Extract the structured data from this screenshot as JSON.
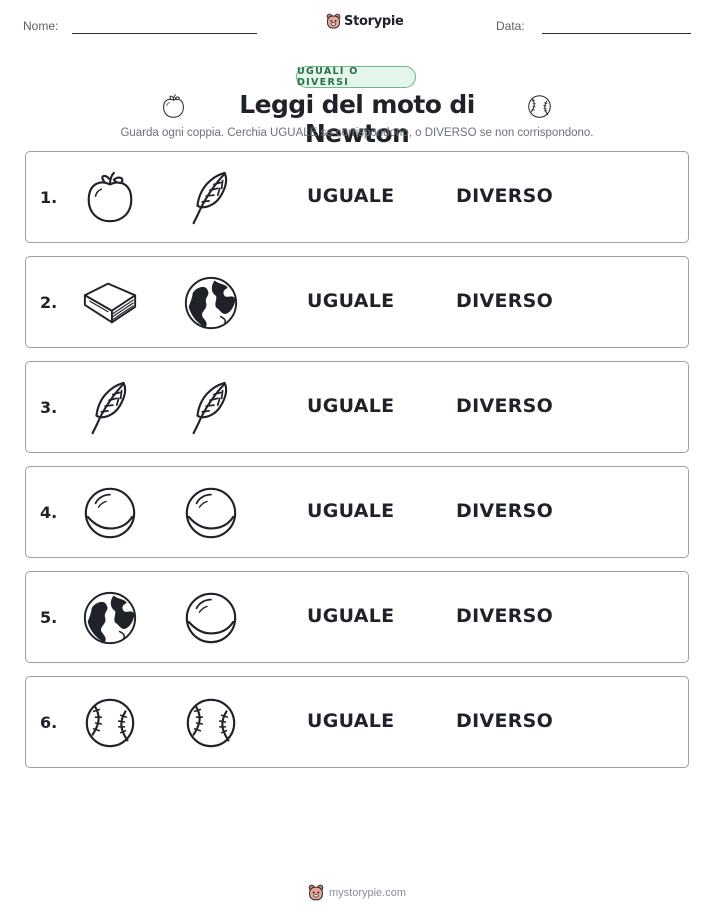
{
  "header": {
    "name_label": "Nome:",
    "date_label": "Data:",
    "brand": "Storypie"
  },
  "badge": "UGUALI O DIVERSI",
  "title": "Leggi del moto di Newton",
  "title_icons": [
    "apple-icon",
    "baseball-icon"
  ],
  "instructions": "Guarda ogni coppia. Cerchia UGUALE se corrispondono, o DIVERSO se non corrispondono.",
  "options": {
    "same": "UGUALE",
    "different": "DIVERSO"
  },
  "rows": [
    {
      "number": "1.",
      "left": "apple-icon",
      "right": "feather-icon"
    },
    {
      "number": "2.",
      "left": "book-icon",
      "right": "earth-icon"
    },
    {
      "number": "3.",
      "left": "feather-icon",
      "right": "feather-icon"
    },
    {
      "number": "4.",
      "left": "marble-icon",
      "right": "marble-icon"
    },
    {
      "number": "5.",
      "left": "earth-icon",
      "right": "marble-icon"
    },
    {
      "number": "6.",
      "left": "baseball-icon",
      "right": "baseball-icon"
    }
  ],
  "footer": "mystorypie.com",
  "colors": {
    "badge_border": "#69b98b",
    "badge_bg": "#e4f5ea",
    "badge_text": "#2f6e49",
    "row_border": "#9ba1aa"
  }
}
